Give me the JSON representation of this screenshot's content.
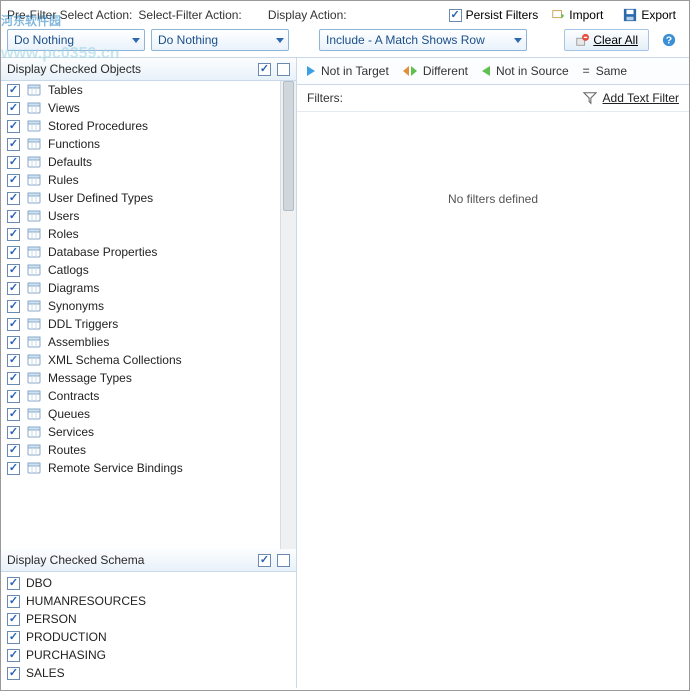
{
  "top": {
    "pre_filter_label": "Pre-Filter Select Action:",
    "select_filter_label": "Select-Filter Action:",
    "display_action_label": "Display Action:",
    "do_nothing": "Do Nothing",
    "display_action_value": "Include - A Match Shows Row",
    "persist_filters": "Persist Filters",
    "import": "Import",
    "export": "Export",
    "clear_all": "Clear All"
  },
  "sections": {
    "objects_title": "Display Checked Objects",
    "schema_title": "Display Checked Schema"
  },
  "objects": [
    "Tables",
    "Views",
    "Stored Procedures",
    "Functions",
    "Defaults",
    "Rules",
    "User Defined Types",
    "Users",
    "Roles",
    "Database Properties",
    "Catlogs",
    "Diagrams",
    "Synonyms",
    "DDL Triggers",
    "Assemblies",
    "XML Schema Collections",
    "Message Types",
    "Contracts",
    "Queues",
    "Services",
    "Routes",
    "Remote Service Bindings"
  ],
  "schema": [
    "DBO",
    "HUMANRESOURCES",
    "PERSON",
    "PRODUCTION",
    "PURCHASING",
    "SALES"
  ],
  "diff": {
    "not_in_target": "Not in Target",
    "different": "Different",
    "not_in_source": "Not in Source",
    "same": "Same"
  },
  "filters": {
    "label": "Filters:",
    "add": "Add Text Filter",
    "none": "No filters defined"
  }
}
